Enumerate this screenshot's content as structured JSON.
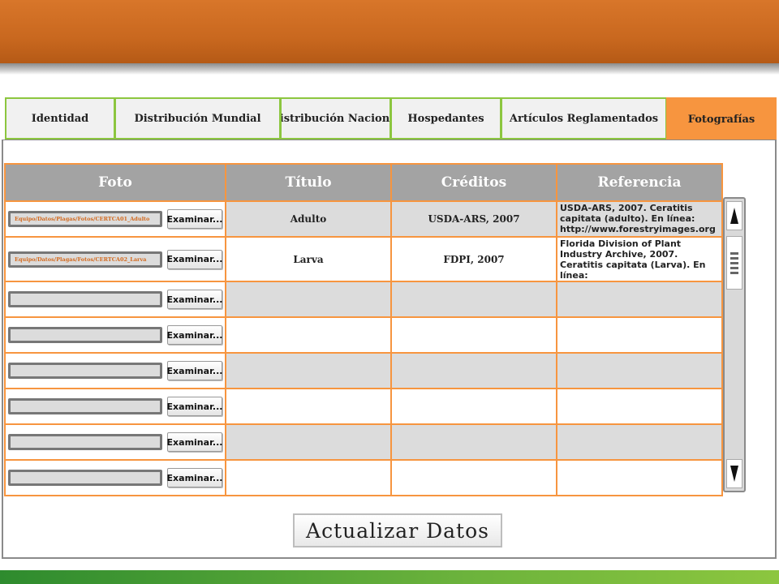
{
  "tabs": [
    {
      "label": "Identidad"
    },
    {
      "label": "Distribución Mundial"
    },
    {
      "label": "Distribución Nacional"
    },
    {
      "label": "Hospedantes"
    },
    {
      "label": "Artículos Reglamentados"
    },
    {
      "label": "Fotografías",
      "active": true
    }
  ],
  "table": {
    "headers": [
      "Foto",
      "Título",
      "Créditos",
      "Referencia"
    ],
    "browse_label": "Examinar...",
    "rows": [
      {
        "path": "Equipo/Datos/Plagas/Fotos/CERTCA01_Adulto",
        "titulo": "Adulto",
        "creditos": "USDA-ARS, 2007",
        "referencia": "USDA-ARS, 2007. Ceratitis capitata (adulto). En línea: http://www.forestryimages.org"
      },
      {
        "path": "Equipo/Datos/Plagas/Fotos/CERTCA02_Larva",
        "titulo": "Larva",
        "creditos": "FDPI, 2007",
        "referencia": "Florida Division of Plant Industry Archive, 2007. Ceratitis capitata (Larva). En línea:"
      },
      {
        "path": "",
        "titulo": "",
        "creditos": "",
        "referencia": ""
      },
      {
        "path": "",
        "titulo": "",
        "creditos": "",
        "referencia": ""
      },
      {
        "path": "",
        "titulo": "",
        "creditos": "",
        "referencia": ""
      },
      {
        "path": "",
        "titulo": "",
        "creditos": "",
        "referencia": ""
      },
      {
        "path": "",
        "titulo": "",
        "creditos": "",
        "referencia": ""
      },
      {
        "path": "",
        "titulo": "",
        "creditos": "",
        "referencia": ""
      }
    ]
  },
  "update_button": "Actualizar Datos",
  "colors": {
    "accent_orange": "#f7953f",
    "banner_orange": "#c9681f",
    "tab_border_green": "#8cc63f",
    "header_gray": "#a3a3a3"
  }
}
